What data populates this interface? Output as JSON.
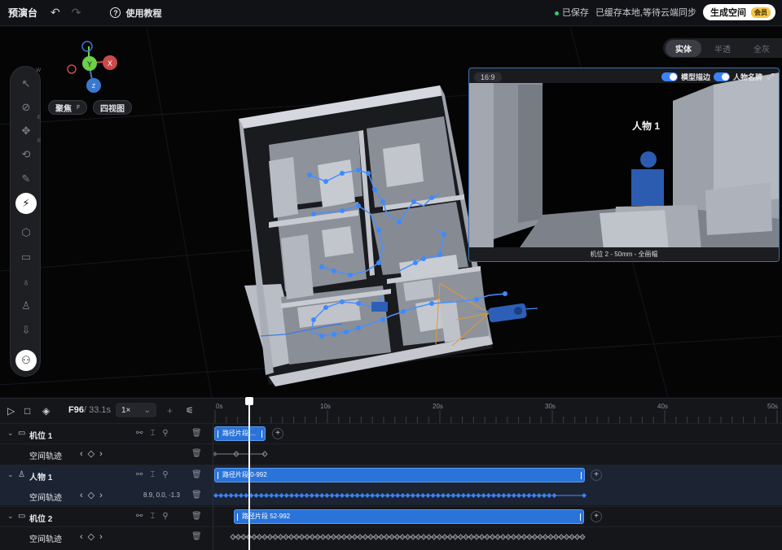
{
  "topbar": {
    "title": "预演台",
    "undo_icon": "undo-icon",
    "redo_icon": "redo-icon",
    "help_label": "使用教程",
    "saved_label": "已保存",
    "sync_status": "已缓存本地,等待云端同步",
    "generate_label": "生成空间",
    "vip_badge": "会员"
  },
  "viewport": {
    "focus_label": "聚焦",
    "focus_key": "F",
    "quad_label": "四视图",
    "gizmo": {
      "x": "X",
      "y": "Y",
      "z": "Z"
    },
    "render_modes": [
      "实体",
      "半透",
      "全灰"
    ],
    "active_mode": "实体",
    "tools": [
      {
        "name": "select-icon",
        "key": "W"
      },
      {
        "name": "rotate-icon",
        "key": ""
      },
      {
        "name": "move-icon",
        "key": "E"
      },
      {
        "name": "orbit-icon",
        "key": "R"
      },
      {
        "name": "pen-icon",
        "key": ""
      },
      {
        "name": "path-icon",
        "key": ""
      },
      {
        "name": "cube-icon",
        "key": ""
      },
      {
        "name": "camera-icon",
        "key": ""
      },
      {
        "name": "light-icon",
        "key": ""
      },
      {
        "name": "person-icon",
        "key": ""
      },
      {
        "name": "import-icon",
        "key": ""
      },
      {
        "name": "node-icon",
        "key": ""
      }
    ]
  },
  "preview": {
    "ratio": "16:9",
    "toggle_outline": "模型描边",
    "toggle_nameplate": "人物名牌",
    "person_label": "人物 1",
    "caption": "机位 2 - 50mm - 全画幅"
  },
  "timeline": {
    "frame": "F96",
    "duration": "/ 33.1s",
    "speed": "1×",
    "ticks": [
      "0s",
      "10s",
      "20s",
      "30s",
      "40s",
      "50s"
    ],
    "rows": [
      {
        "type": "track",
        "name": "机位 1",
        "icon": "camera-icon",
        "clip": "路径片段 ..."
      },
      {
        "type": "sub",
        "name": "空间轨迹"
      },
      {
        "type": "track",
        "name": "人物 1",
        "icon": "person-icon",
        "clip": "路径片段 0-992"
      },
      {
        "type": "sub",
        "name": "空间轨迹",
        "coords": "8.9, 0.0, -1.3"
      },
      {
        "type": "track",
        "name": "机位 2",
        "icon": "camera-icon",
        "clip": "路径片段 52-992"
      },
      {
        "type": "sub",
        "name": "空间轨迹"
      }
    ]
  }
}
